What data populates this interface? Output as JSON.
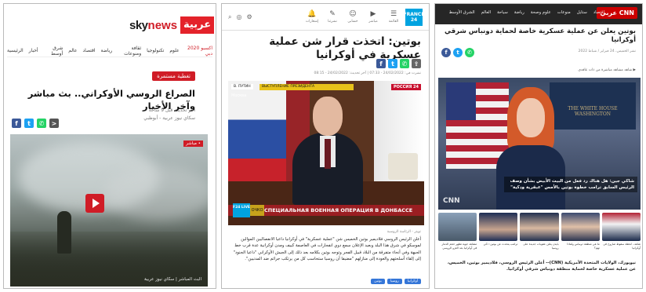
{
  "panel1": {
    "logo": {
      "sky": "sky",
      "news": "news",
      "arabic": "عربية"
    },
    "nav": [
      "الرئيسية",
      "أخبار",
      "شرق أوسط",
      "عالم",
      "اقتصاد",
      "رياضة",
      "ثقافة ومنوعات",
      "تكنولوجيا",
      "علوم",
      "اكسبو 2020 دبي",
      "تغطية مستمرة"
    ],
    "tag": "تغطية مستمرة",
    "headline": "الصراع الروسي الأوكراني.. بث مباشر وآخر الأخبار",
    "updated": "آخر تحديث قبل 9 ساعة",
    "source": "سكاي نيوز عربية - أبوظبي",
    "live": "• مباشر",
    "caption": "البث المباشر | سكاي نيوز عربية"
  },
  "panel2": {
    "topicons": [
      {
        "icon": "☰",
        "label": "القائمة"
      },
      {
        "icon": "▶",
        "label": "مباشر"
      },
      {
        "icon": "☺",
        "label": "حسابي"
      },
      {
        "icon": "✎",
        "label": "نشرتنا"
      },
      {
        "icon": "🔔",
        "label": "إشعارات"
      }
    ],
    "leftic": [
      "⚙",
      "◎",
      "⌕"
    ],
    "f24": "FRANCE 24",
    "headline": "بوتين: اتخذت قرار شن عملية عسكرية في أوكرانيا",
    "meta": "نشرت في: 24/02/2022 - 07:33 | آخر تحديث: 24/02/2022 - 08:15",
    "video": {
      "logo": "В. ПУТИН",
      "ticker": "ВЫСТУПЛЕНИЕ ПРЕЗИДЕНТА",
      "channel": "РОССИЯ 24",
      "city": "Москва",
      "f24bug": "F24 LIVE",
      "ochko": "ОЧКО",
      "lowerthird": "СПЕЦИАЛЬНАЯ ВОЕННАЯ ОПЕРАЦИЯ В ДОНБАССЕ"
    },
    "credit": "تويتر - الرئاسة الروسية",
    "body": "أعلن الرئيس الروسي فلاديمير بوتين الخميس شن \"عملية عسكرية\" في أوكرانيا داعيا الانفصاليين الموالين لموسكو في شرق هذا البلد وبعيد الإعلان سمع دوي انفجارات في العاصمة كييف ومدن أوكرانية عدة قرب خط الجبهة وفي أنحاء متفرقة من البلاد قبيل الفجر وتوجه بوتين بكلامه بعد ذلك إلى الجيش الأوكراني \"داعيا الجنود\" إلى إلقاء أسلحتهم والعودة إلى منازلهم \"مضيفا أن روسيا ستحاسب كل من يرتكب جرائم ضد المدنيين\".",
    "tags": [
      "أوكرانيا",
      "روسيا",
      "بوتين"
    ]
  },
  "panel3": {
    "cnn": "CNN عربي",
    "nav": [
      "الشرق الأوسط",
      "العالم",
      "سياحة",
      "رياضة",
      "علوم وصحة",
      "منوعات",
      "ستايل",
      "اقتصاد"
    ],
    "headline": "بوتين يعلن عن عملية عسكرية خاصة لحماية دونباس شرقي أوكرانيا",
    "byline": "نشر الخميس، 24 فبراير / شباط 2022",
    "byline2": "▶ شاهد مشاهد مباشرة من ذات عاقدي",
    "video_caption": "شاكي جين: هل هناك رد فعل من البيت الأبيض بشأن وصف الرئيس السابق ترامب خطوة بوتين بالأمس \"عبقرية وذكية\"",
    "wh": "THE WHITE HOUSE WASHINGTON",
    "cnnbug": "CNN",
    "thumb_captions": [
      "مشاهد جوية تظهر حجم الدمار في أوكرانيا بعد الغزو الروسي",
      "ترامب يتحدث عن بوتين: ذكي",
      "بايدن يعلن عقوبات جديدة على روسيا",
      "ما هي منطقة دونباس ولماذا تهم؟",
      "شاهد.. لحظة سقوط صاروخ في أوكرانيا"
    ],
    "body": "نيويورك، الولايات المتحدة الأمريكية (CNN)-- أعلن الرئيس الروسي، فلاديمير بوتين، الخميس، عن عملية عسكرية خاصة لحماية منطقة دونباس شرقي أوكرانيا."
  },
  "colors": {
    "sky_red": "#d01c26",
    "f24_blue": "#00a3e0",
    "cnn_red": "#cc0000"
  }
}
